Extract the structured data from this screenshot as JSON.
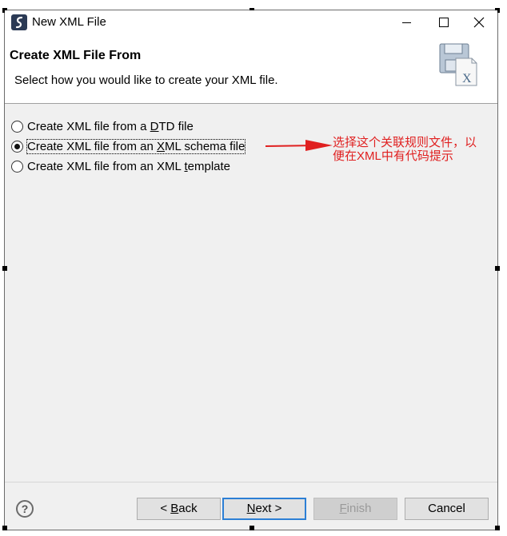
{
  "window": {
    "title": "New XML File"
  },
  "header": {
    "title": "Create XML File From",
    "description": "Select how you would like to create your XML file."
  },
  "options": [
    {
      "label_before": "Create XML file from a ",
      "mnemonic": "D",
      "label_after": "TD file",
      "selected": false
    },
    {
      "label_before": "Create XML file from an ",
      "mnemonic": "X",
      "label_after": "ML schema file",
      "selected": true
    },
    {
      "label_before": "Create XML file from an XML ",
      "mnemonic": "t",
      "label_after": "emplate",
      "selected": false
    }
  ],
  "annotation": {
    "text_line1": "选择这个关联规则文件，以",
    "text_line2": "便在XML中有代码提示",
    "color": "#e02020"
  },
  "footer": {
    "help_label": "?",
    "back": {
      "prefix": "< ",
      "mnemonic": "B",
      "rest": "ack"
    },
    "next": {
      "mnemonic": "N",
      "rest": "ext >"
    },
    "finish": {
      "mnemonic": "F",
      "rest": "inish"
    },
    "cancel": "Cancel"
  },
  "icons": {
    "app": "eclipse-app-icon",
    "minimize": "minimize-icon",
    "maximize": "maximize-icon",
    "close": "close-icon",
    "banner": "xml-file-wizard-icon",
    "help": "help-icon"
  }
}
